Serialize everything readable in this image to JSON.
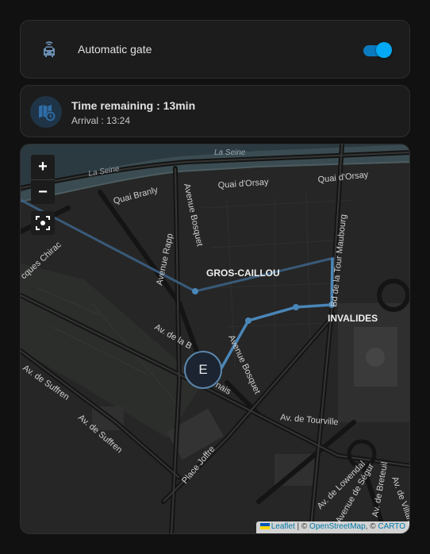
{
  "gate": {
    "label": "Automatic gate",
    "icon": "car-gate-icon",
    "toggle_on": true,
    "accent": "#03a9f4"
  },
  "travel": {
    "title": "Time remaining : 13min",
    "arrival": "Arrival : 13:24",
    "icon": "map-clock-icon"
  },
  "map": {
    "zoom_in": "+",
    "zoom_out": "−",
    "marker_label": "E",
    "route_color": "#4a86b8",
    "attribution": {
      "leaflet": "Leaflet",
      "sep1": " | © ",
      "osm": "OpenStreetMap",
      "sep2": ", © ",
      "carto": "CARTO"
    },
    "labels": {
      "seine_top": "La Seine",
      "seine_left": "La Seine",
      "quai_branly": "Quai Branly",
      "quai_orsay_1": "Quai d'Orsay",
      "quai_orsay_2": "Quai d'Orsay",
      "av_rapp": "Avenue Rapp",
      "av_bosquet_top": "Avenue Bosquet",
      "av_bosquet_bottom": "Avenue Bosquet",
      "bd_tour_maubourg": "Bd de la Tour Maubourg",
      "cques_chirac": "cques Chirac",
      "gros_caillou": "GROS-CAILLOU",
      "invalides": "INVALIDES",
      "av_la_bourdonnais_1": "Av. de la B",
      "av_la_bourdonnais_2": "nais",
      "av_suffren_1": "Av. de Suffren",
      "av_suffren_2": "Av. de Suffren",
      "av_tourville": "Av. de Tourville",
      "place_joffre": "Place Joffre",
      "av_lowendal": "Av. de Lowendal",
      "av_segur": "Avenue de Ségur",
      "av_breteuil": "Av. de Breteuil",
      "av_villars": "Av. de Villars"
    }
  }
}
